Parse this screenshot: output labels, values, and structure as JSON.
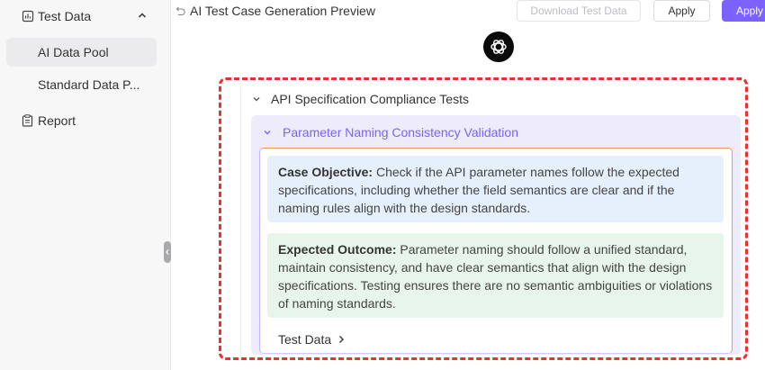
{
  "sidebar": {
    "group_label": "Test Data",
    "items": [
      {
        "label": "AI Data Pool",
        "active": true
      },
      {
        "label": "Standard Data P...",
        "active": false
      }
    ],
    "report_label": "Report"
  },
  "header": {
    "title": "AI Test Case Generation Preview",
    "download_label": "Download Test Data",
    "apply_label": "Apply",
    "apply_primary_label": "Apply"
  },
  "content": {
    "section_title": "API Specification Compliance Tests",
    "subsection_title": "Parameter Naming Consistency Validation",
    "objective_label": "Case Objective:",
    "objective_text": " Check if the API parameter names follow the expected specifications, including whether the field semantics are clear and if the naming rules align with the design standards.",
    "outcome_label": "Expected Outcome:",
    "outcome_text": " Parameter naming should follow a unified standard, maintain consistency, and have clear semantics that align with the design specifications. Testing ensures there are no semantic ambiguities or violations of naming standards.",
    "test_data_link": "Test Data"
  },
  "colors": {
    "accent": "#7b61ff",
    "highlight_border": "#e8322f",
    "objective_bg": "#e6f0fc",
    "outcome_bg": "#e8f5ea",
    "subpanel_bg": "#eeebfa"
  }
}
